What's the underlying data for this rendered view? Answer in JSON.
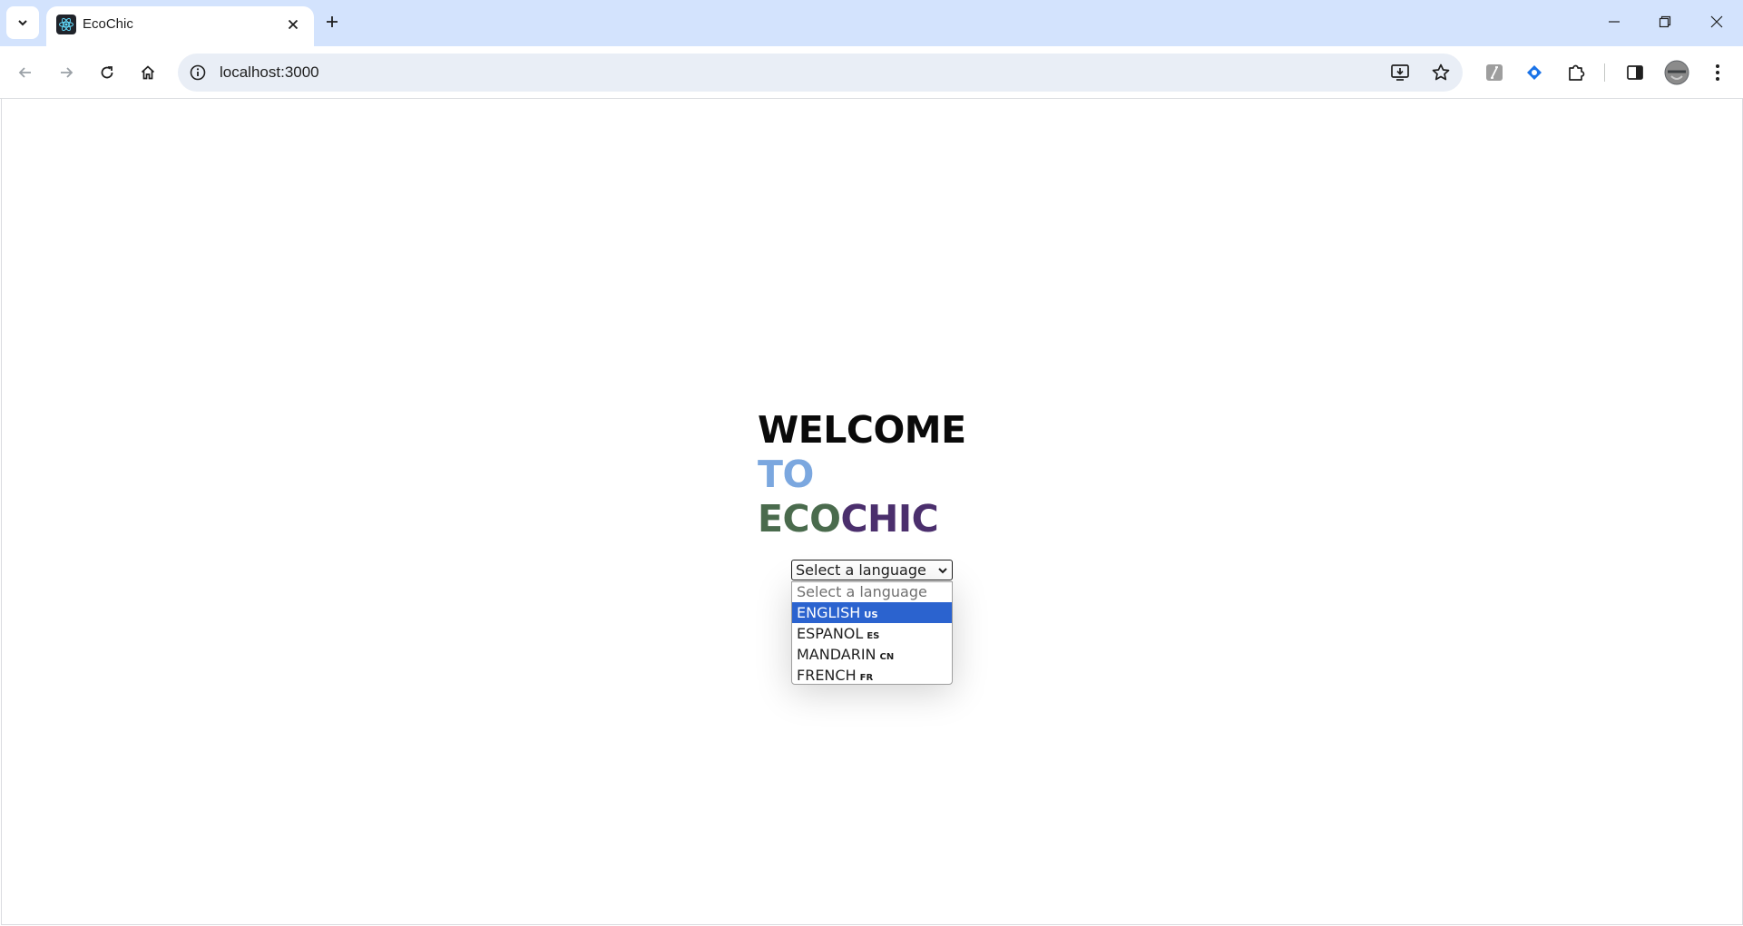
{
  "browser": {
    "tab": {
      "title": "EcoChic",
      "favicon": "react-atom-icon"
    },
    "address": {
      "url": "localhost:3000"
    },
    "icons": {
      "tab_search": "chevron-down-icon",
      "tab_close": "close-icon",
      "new_tab": "plus-icon",
      "minimize": "minimize-icon",
      "restore": "restore-icon",
      "window_close": "close-icon",
      "back": "arrow-left-icon",
      "forward": "arrow-right-icon",
      "reload": "reload-icon",
      "home": "home-icon",
      "site_info": "info-icon",
      "install_app": "install-app-icon",
      "bookmark": "star-icon",
      "extension_1": "extension-gray-icon",
      "extension_2": "extension-blue-tag-icon",
      "extensions": "puzzle-icon",
      "side_panel": "side-panel-icon",
      "profile": "avatar",
      "menu": "kebab-menu-icon"
    }
  },
  "page": {
    "heading": {
      "line1": "WELCOME",
      "line2": "TO",
      "line3_part1": "ECO",
      "line3_part2": "CHIC"
    },
    "language_select": {
      "current_label": "Select a language",
      "options": [
        {
          "label": "Select a language",
          "code": "",
          "placeholder": true
        },
        {
          "label": "ENGLISH",
          "code": "US",
          "selected": true
        },
        {
          "label": "ESPANOL",
          "code": "ES"
        },
        {
          "label": "MANDARIN",
          "code": "CN"
        },
        {
          "label": "FRENCH",
          "code": "FR"
        }
      ]
    }
  },
  "colors": {
    "tabstrip_bg": "#d3e3fd",
    "omnibox_bg": "#e9eef6",
    "welcome": "#0a0a0a",
    "to": "#7ba7df",
    "eco": "#4a6b4d",
    "chic": "#4b2f6d",
    "option_highlight": "#2b63cf"
  }
}
